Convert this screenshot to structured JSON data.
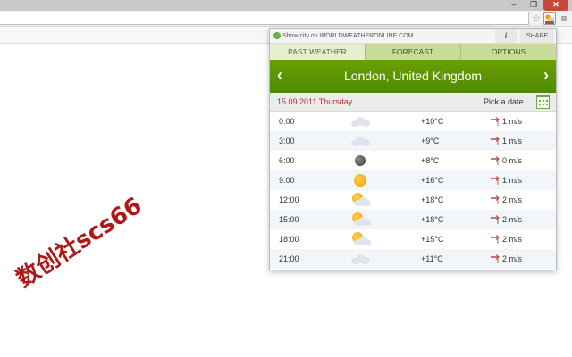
{
  "popup": {
    "show_city_text": "Show city on WORLDWEATHERONLINE.COM",
    "info_label": "i",
    "share_label": "SHARE",
    "tabs": [
      {
        "label": "PAST WEATHER",
        "active": true
      },
      {
        "label": "FORECAST",
        "active": false
      },
      {
        "label": "OPTIONS",
        "active": false
      }
    ],
    "prev_arrow": "‹",
    "next_arrow": "›",
    "city": "London, United Kingdom",
    "date": "15.09.2011 Thursday",
    "pick_date_label": "Pick a date",
    "rows": [
      {
        "time": "0:00",
        "icon": "cloudy-icon",
        "temp": "+10°C",
        "wind": "1 m/s"
      },
      {
        "time": "3:00",
        "icon": "cloudy-icon",
        "temp": "+9°C",
        "wind": "1 m/s"
      },
      {
        "time": "6:00",
        "icon": "moon-icon",
        "temp": "+8°C",
        "wind": "0 m/s"
      },
      {
        "time": "9:00",
        "icon": "sunny-icon",
        "temp": "+16°C",
        "wind": "1 m/s"
      },
      {
        "time": "12:00",
        "icon": "partly-cloudy-icon",
        "temp": "+18°C",
        "wind": "2 m/s"
      },
      {
        "time": "15:00",
        "icon": "partly-cloudy-icon",
        "temp": "+18°C",
        "wind": "2 m/s"
      },
      {
        "time": "18:00",
        "icon": "partly-cloudy-icon",
        "temp": "+15°C",
        "wind": "2 m/s"
      },
      {
        "time": "21:00",
        "icon": "cloudy-icon",
        "temp": "+11°C",
        "wind": "2 m/s"
      }
    ]
  },
  "browser": {
    "window_controls": [
      "–",
      "❐",
      "✕"
    ],
    "star_glyph": "☆",
    "menu_glyph": "≡"
  },
  "watermark": "数创社scs66",
  "colors": {
    "accent_green": "#5a9400",
    "date_red": "#b03030",
    "tab_green": "#c8dc9a"
  }
}
